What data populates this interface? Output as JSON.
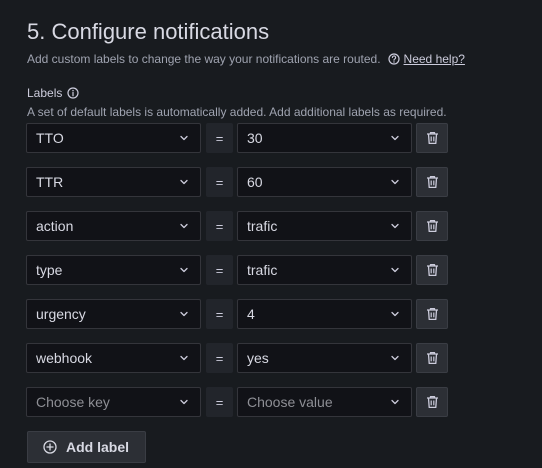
{
  "section": {
    "title": "5. Configure notifications",
    "subtitle": "Add custom labels to change the way your notifications are routed.",
    "help_link": "Need help?"
  },
  "labels": {
    "heading": "Labels",
    "description": "A set of default labels is automatically added. Add additional labels as required.",
    "operator": "=",
    "rows": [
      {
        "key": "TTO",
        "value": "30"
      },
      {
        "key": "TTR",
        "value": "60"
      },
      {
        "key": "action",
        "value": "trafic"
      },
      {
        "key": "type",
        "value": "trafic"
      },
      {
        "key": "urgency",
        "value": "4"
      },
      {
        "key": "webhook",
        "value": "yes"
      }
    ],
    "new_row": {
      "key_placeholder": "Choose key",
      "value_placeholder": "Choose value"
    },
    "add_label": "Add label"
  },
  "icons": {
    "help": "help-circle-icon",
    "info": "info-circle-icon",
    "chevron": "chevron-down-icon",
    "delete": "trash-icon",
    "add": "plus-circle-icon"
  },
  "colors": {
    "background": "#181b1f",
    "input_background": "#111217",
    "border": "#34353b",
    "text": "#d8d9e3",
    "muted_text": "#9fa3b0",
    "button_background": "#2c2f35"
  }
}
